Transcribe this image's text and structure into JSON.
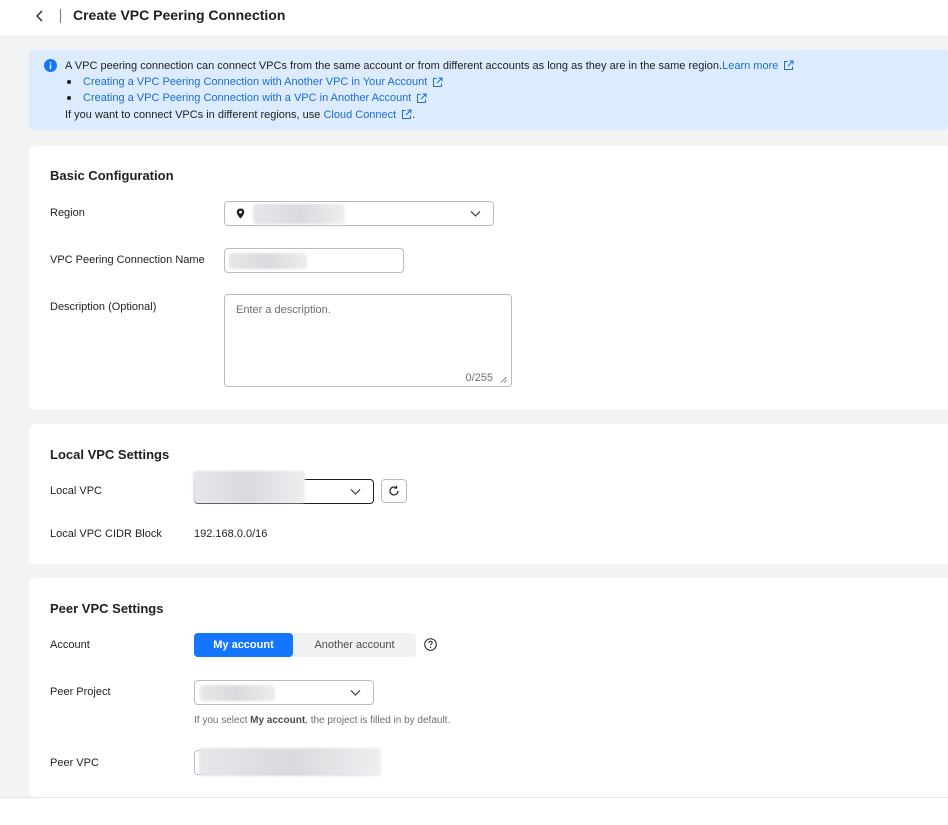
{
  "header": {
    "title": "Create VPC Peering Connection"
  },
  "notice": {
    "line1_text": "A VPC peering connection can connect VPCs from the same account or from different accounts as long as they are in the same region.",
    "learn_more": "Learn more",
    "bullet1": "Creating a VPC Peering Connection with Another VPC in Your Account",
    "bullet2": "Creating a VPC Peering Connection with a VPC in Another Account",
    "line4_prefix": "If you want to connect VPCs in different regions, use",
    "cloud_connect": "Cloud Connect",
    "line4_suffix": "."
  },
  "basic": {
    "title": "Basic Configuration",
    "region_label": "Region",
    "name_label": "VPC Peering Connection Name",
    "description_label": "Description (Optional)",
    "description_placeholder": "Enter a description.",
    "description_counter": "0/255"
  },
  "local": {
    "title": "Local VPC Settings",
    "vpc_label": "Local VPC",
    "cidr_label": "Local VPC CIDR Block",
    "cidr_value": "192.168.0.0/16"
  },
  "peer": {
    "title": "Peer VPC Settings",
    "account_label": "Account",
    "account_options": [
      "My account",
      "Another account"
    ],
    "project_label": "Peer Project",
    "hint_prefix": "If you select",
    "hint_bold": "My account",
    "hint_suffix": ", the project is filled in by default.",
    "vpc_label": "Peer VPC"
  },
  "colors": {
    "accent": "#1476ff",
    "link": "#1a6ddb",
    "notice_bg": "#dcebfe"
  }
}
